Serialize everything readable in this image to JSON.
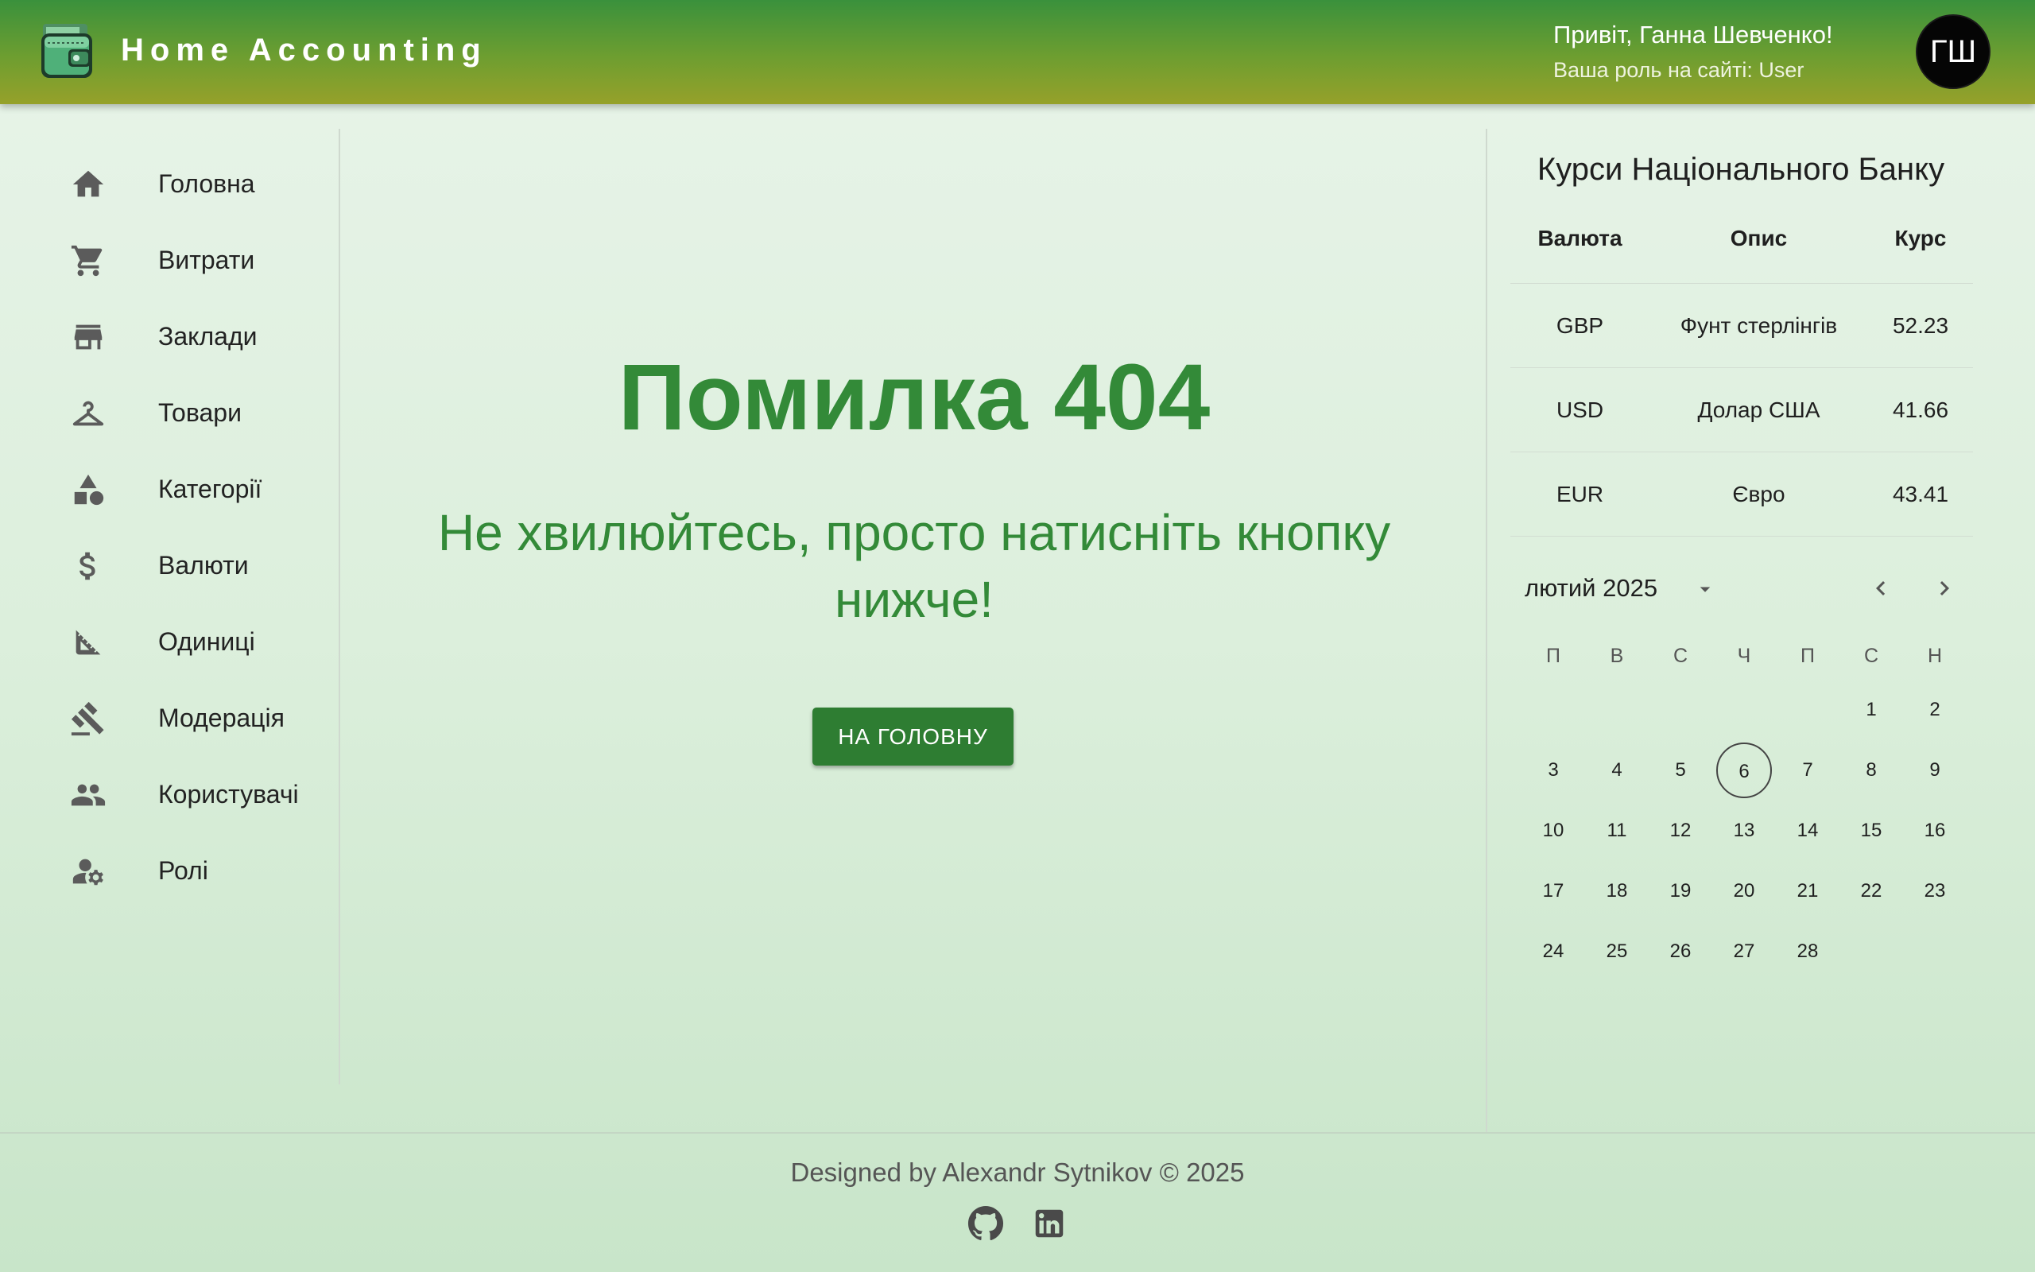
{
  "header": {
    "title": "Home Accounting",
    "greeting": "Привіт, Ганна Шевченко!",
    "role": "Ваша роль на сайті: User",
    "avatar_initials": "ГШ",
    "logo_icon": "wallet-icon"
  },
  "sidebar": {
    "items": [
      {
        "label": "Головна",
        "icon": "home-icon"
      },
      {
        "label": "Витрати",
        "icon": "cart-icon"
      },
      {
        "label": "Заклади",
        "icon": "store-icon"
      },
      {
        "label": "Товари",
        "icon": "hanger-icon"
      },
      {
        "label": "Категорії",
        "icon": "shapes-icon"
      },
      {
        "label": "Валюти",
        "icon": "dollar-icon"
      },
      {
        "label": "Одиниці",
        "icon": "ruler-icon"
      },
      {
        "label": "Модерація",
        "icon": "gavel-icon"
      },
      {
        "label": "Користувачі",
        "icon": "people-icon"
      },
      {
        "label": "Ролі",
        "icon": "user-gear-icon"
      }
    ]
  },
  "main": {
    "error_title": "Помилка 404",
    "error_subtitle": "Не хвилюйтесь, просто натисніть кнопку нижче!",
    "home_button": "НА ГОЛОВНУ"
  },
  "rates": {
    "title": "Курси Національного Банку",
    "headers": [
      "Валюта",
      "Опис",
      "Курс"
    ],
    "rows": [
      [
        "GBP",
        "Фунт стерлінгів",
        "52.23"
      ],
      [
        "USD",
        "Долар США",
        "41.66"
      ],
      [
        "EUR",
        "Євро",
        "43.41"
      ]
    ]
  },
  "calendar": {
    "month_label": "лютий 2025",
    "weekdays": [
      "П",
      "В",
      "С",
      "Ч",
      "П",
      "С",
      "Н"
    ],
    "first_weekday_index": 5,
    "days_in_month": 28,
    "selected_day": 6
  },
  "footer": {
    "credit": "Designed by Alexandr Sytnikov © 2025",
    "links": [
      "github-icon",
      "linkedin-icon"
    ]
  },
  "colors": {
    "header_top": "#3a913c",
    "header_bottom": "#96a12a",
    "accent": "#338a38",
    "button": "#2e7d32"
  }
}
